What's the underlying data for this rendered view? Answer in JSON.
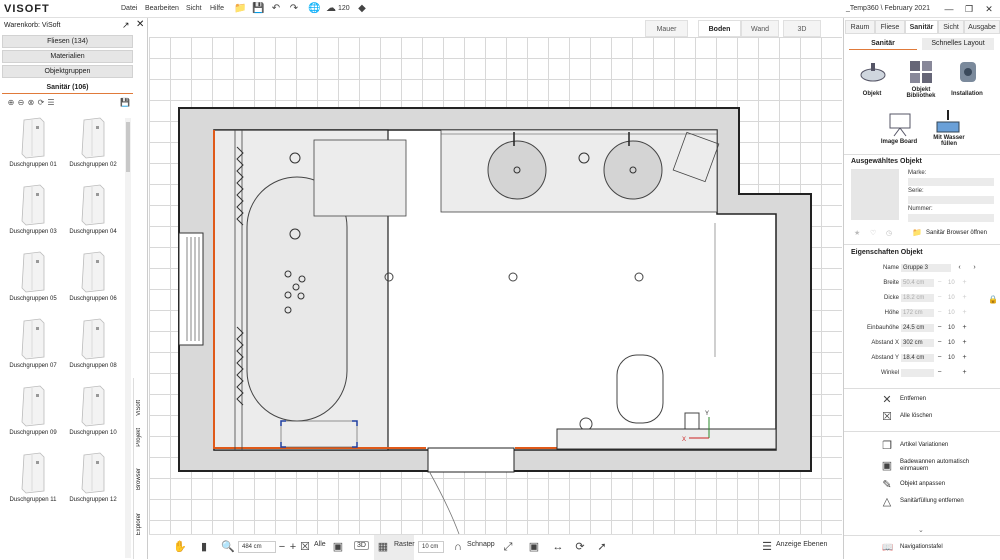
{
  "app": {
    "logo": "VISOFT",
    "window_title": "_Temp360 \\ February 2021"
  },
  "menu": [
    "Datei",
    "Bearbeiten",
    "Sicht",
    "Hilfe"
  ],
  "topbar": {
    "views_count": "120"
  },
  "left_panel": {
    "title": "Warenkorb: ViSoft",
    "buttons": [
      "Fliesen (134)",
      "Materialien",
      "Objektgruppen"
    ],
    "active_category": "Sanitär (106)",
    "items": [
      "Duschgruppen 01",
      "Duschgruppen 02",
      "Duschgruppen 03",
      "Duschgruppen 04",
      "Duschgruppen 05",
      "Duschgruppen 06",
      "Duschgruppen 07",
      "Duschgruppen 08",
      "Duschgruppen 09",
      "Duschgruppen 10",
      "Duschgruppen 11",
      "Duschgruppen 12"
    ],
    "vertical_tabs": [
      "ViSoft",
      "Projekt",
      "Browser",
      "Explorer"
    ]
  },
  "view_tabs": [
    "Mauer",
    "Boden",
    "Wand",
    "3D"
  ],
  "active_view_tab": "Boden",
  "bottom_toolbar": {
    "zoom_value": "484 cm",
    "all_label": "Alle",
    "three_d_label": "3D",
    "raster_label": "Raster",
    "raster_value": "10 cm",
    "snap_label": "Schnapp",
    "layers_label": "Anzeige Ebenen"
  },
  "right_panel": {
    "tabs": [
      "Raum",
      "Fliese",
      "Sanitär",
      "Sicht",
      "Ausgabe"
    ],
    "active_tab": "Sanitär",
    "subtabs": [
      "Sanitär",
      "Schnelles Layout"
    ],
    "tools": [
      "Objekt",
      "Objekt Bibliothek",
      "Installation",
      "Image Board",
      "Mit Wasser füllen"
    ],
    "selected_object": {
      "heading": "Ausgewähltes Objekt",
      "marke_label": "Marke:",
      "serie_label": "Serie:",
      "nummer_label": "Nummer:",
      "browser_button": "Sanitär Browser öffnen"
    },
    "properties": {
      "heading": "Eigenschaften Objekt",
      "rows": [
        {
          "label": "Name",
          "value": "Gruppe 3",
          "step": ""
        },
        {
          "label": "Breite",
          "value": "50.4 cm",
          "step": "10"
        },
        {
          "label": "Dicke",
          "value": "18.2 cm",
          "step": "10"
        },
        {
          "label": "Höhe",
          "value": "172 cm",
          "step": "10"
        },
        {
          "label": "Einbauhöhe",
          "value": "24.5 cm",
          "step": "10"
        },
        {
          "label": "Abstand X",
          "value": "302 cm",
          "step": "10"
        },
        {
          "label": "Abstand Y",
          "value": "18.4 cm",
          "step": "10"
        },
        {
          "label": "Winkel",
          "value": "",
          "step": ""
        }
      ]
    },
    "actions": [
      "Entfernen",
      "Alle löschen",
      "Artikel Variationen",
      "Badewannen automatisch einmauern",
      "Objekt anpassen",
      "Sanitärfüllung entfernen"
    ],
    "navigation": "Navigationstafel"
  },
  "colors": {
    "accent": "#e05a1a",
    "wall": "#222222",
    "wall_fill": "#d9d9d9",
    "grid": "#d8d8d8"
  }
}
